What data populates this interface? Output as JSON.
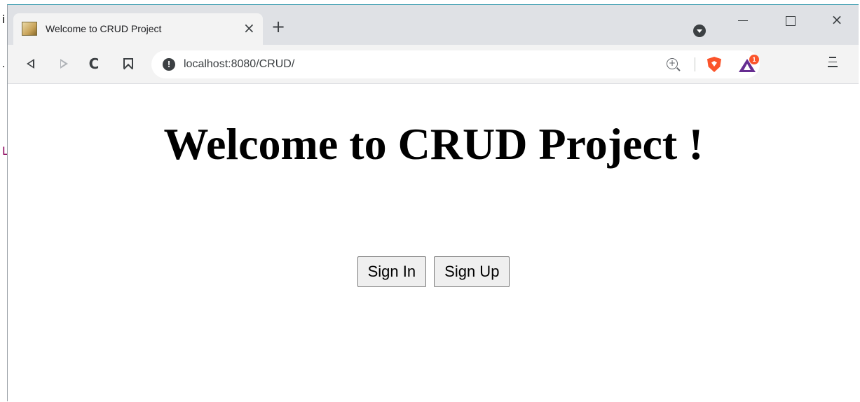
{
  "desktop": {
    "fragments": [
      "i",
      ".",
      "L"
    ]
  },
  "tab": {
    "title": "Welcome to CRUD Project",
    "close_glyph": "×",
    "new_tab_glyph": "+"
  },
  "window_controls": {
    "close_glyph": "×"
  },
  "toolbar": {
    "reload_glyph": "C",
    "url": "localhost:8080/CRUD/",
    "info_glyph": "!",
    "zoom_glyph": "+",
    "rewards_badge": "1"
  },
  "page": {
    "heading": "Welcome to CRUD Project !",
    "buttons": {
      "sign_in": "Sign In",
      "sign_up": "Sign Up"
    }
  },
  "icons": {
    "brave_shield": "brave-shield-icon",
    "brave_rewards": "brave-rewards-icon",
    "menu": "hamburger-menu-icon"
  },
  "colors": {
    "brave_orange": "#fb542b",
    "rewards_purple": "#662d91",
    "tabstrip_bg": "#dfe1e5",
    "toolbar_bg": "#f3f3f3"
  }
}
